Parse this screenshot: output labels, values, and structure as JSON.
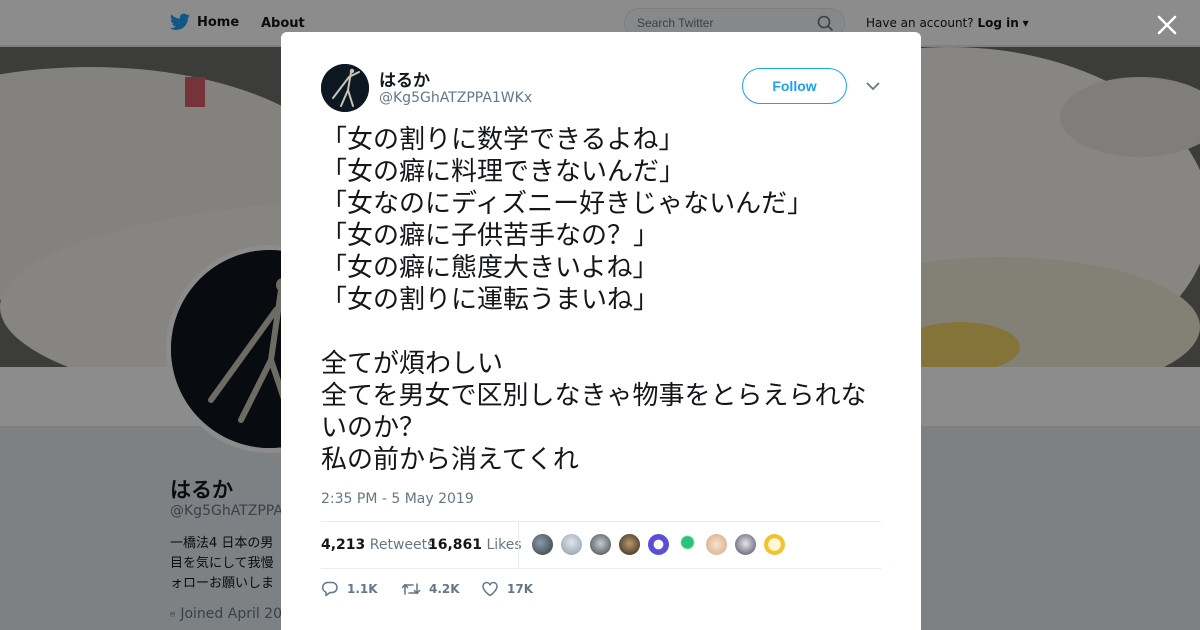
{
  "nav": {
    "home_label": "Home",
    "about_label": "About",
    "search_placeholder": "Search Twitter",
    "have_account": "Have an account?",
    "login_label": "Log in"
  },
  "profile": {
    "name": "はるか",
    "handle": "@Kg5GhATZPPA1WKx",
    "bio_lines": [
      "一橋法4 日本の男",
      "目を気にして我慢",
      "ォローお願いしま"
    ],
    "joined": "Joined April 20"
  },
  "tweet": {
    "author_name": "はるか",
    "author_handle": "@Kg5GhATZPPA1WKx",
    "follow_label": "Follow",
    "text": "「女の割りに数学できるよね」\n「女の癖に料理できないんだ」\n「女なのにディズニー好きじゃないんだ」\n「女の癖に子供苦手なの？」\n「女の癖に態度大きいよね」\n「女の割りに運転うまいね」\n\n全てが煩わしい\n全てを男女で区別しなきゃ物事をとらえられないのか？\n私の前から消えてくれ",
    "timestamp": "2:35 PM - 5 May 2019",
    "retweets_count": "4,213",
    "retweets_label": "Retweets",
    "likes_count": "16,861",
    "likes_label": "Likes",
    "reply_count": "1.1K",
    "retweet_action_count": "4.2K",
    "like_action_count": "17K"
  },
  "colors": {
    "accent": "#1da1f2",
    "text": "#14171a",
    "muted": "#657786"
  },
  "icons": [
    "twitter-bird-icon",
    "search-icon",
    "chevron-down-icon",
    "close-icon",
    "reply-icon",
    "retweet-icon",
    "heart-icon",
    "calendar-icon"
  ]
}
